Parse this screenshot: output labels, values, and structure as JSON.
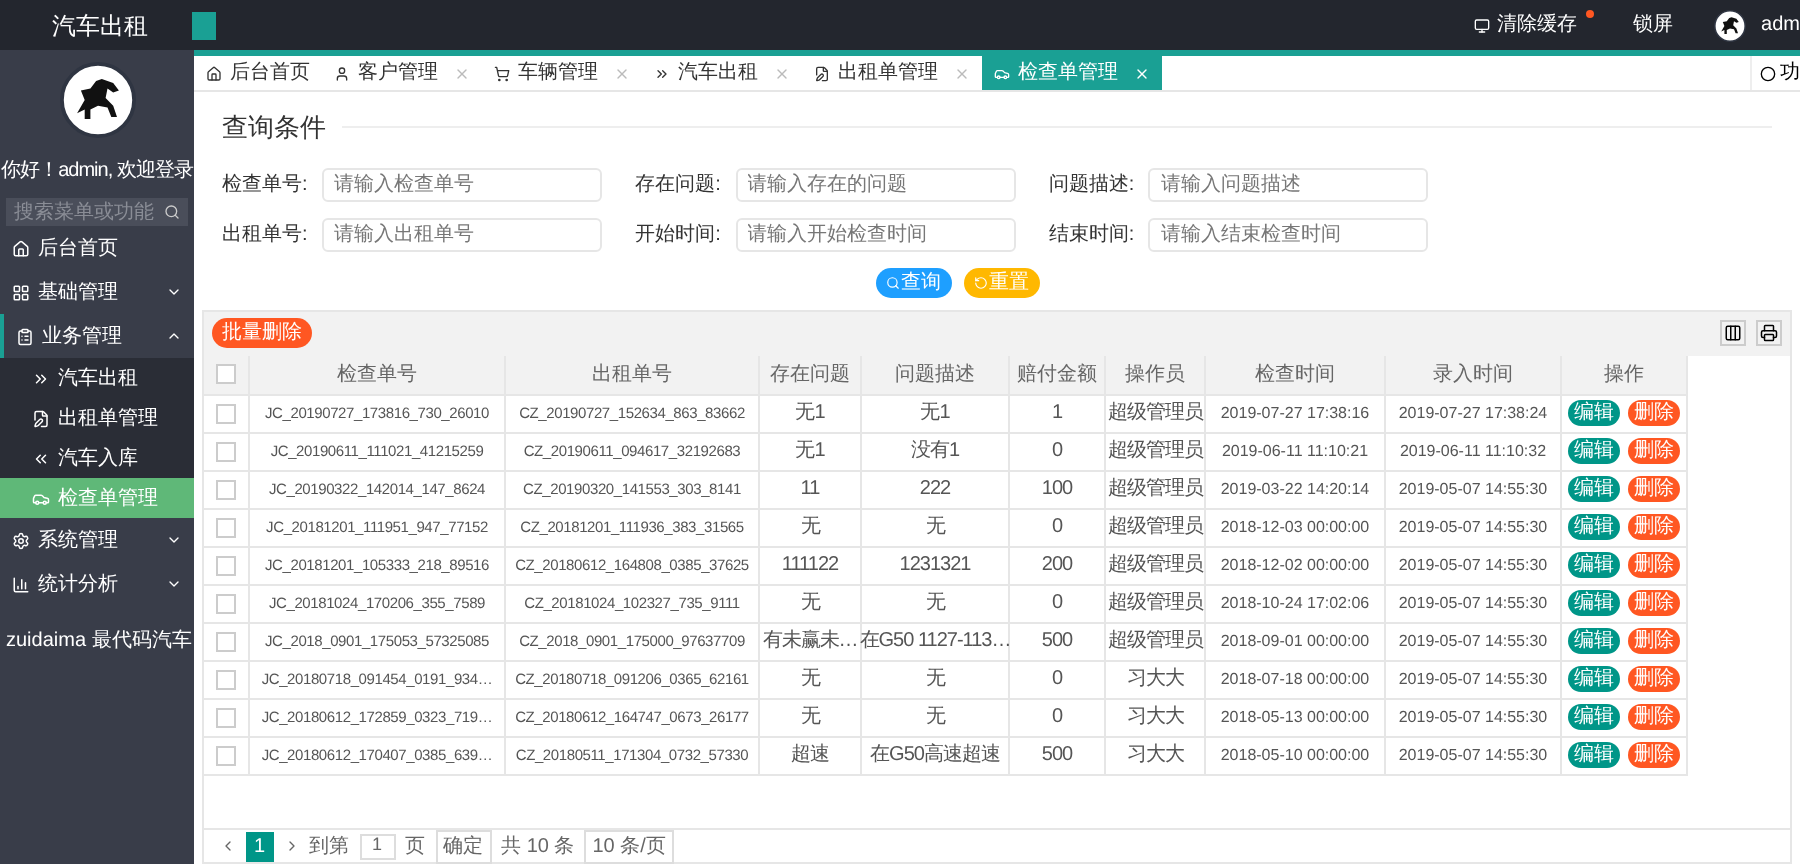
{
  "brand": "汽车出租",
  "topbar": {
    "items": [
      {
        "kind": "cache",
        "label": "清除缓存",
        "badge": true
      },
      {
        "kind": "lock",
        "label": "锁屏"
      },
      {
        "kind": "user",
        "label": "adm"
      }
    ]
  },
  "sidebar": {
    "greeting": "你好！admin, 欢迎登录",
    "search": {
      "placeholder": "搜索菜单或功能"
    },
    "items": [
      {
        "kind": "home",
        "label": "后台首页",
        "expanded": false
      },
      {
        "kind": "grid",
        "label": "基础管理",
        "expanded": false
      },
      {
        "kind": "business",
        "label": "业务管理",
        "expanded": true,
        "children": [
          {
            "kind": "rent",
            "label": "汽车出租",
            "selected": false
          },
          {
            "kind": "order",
            "label": "出租单管理",
            "selected": false
          },
          {
            "kind": "store",
            "label": "汽车入库",
            "selected": false
          },
          {
            "kind": "check",
            "label": "检查单管理",
            "selected": true
          }
        ]
      },
      {
        "kind": "gear",
        "label": "系统管理",
        "expanded": false
      },
      {
        "kind": "stats",
        "label": "统计分析",
        "expanded": false
      }
    ],
    "footer": "zuidaima 最代码汽车"
  },
  "tabs": [
    {
      "kind": "home",
      "label": "后台首页",
      "closable": false,
      "selected": false
    },
    {
      "kind": "user",
      "label": "客户管理",
      "closable": true,
      "selected": false
    },
    {
      "kind": "cart",
      "label": "车辆管理",
      "closable": true,
      "selected": false
    },
    {
      "kind": "rent",
      "label": "汽车出租",
      "closable": true,
      "selected": false
    },
    {
      "kind": "order",
      "label": "出租单管理",
      "closable": true,
      "selected": false
    },
    {
      "kind": "check",
      "label": "检查单管理",
      "closable": true,
      "selected": true
    }
  ],
  "tab_menu": "功",
  "query": {
    "title": "查询条件",
    "fields": [
      {
        "label": "检查单号:",
        "placeholder": "请输入检查单号"
      },
      {
        "label": "存在问题:",
        "placeholder": "请输入存在的问题"
      },
      {
        "label": "问题描述:",
        "placeholder": "请输入问题描述"
      },
      {
        "label": "出租单号:",
        "placeholder": "请输入出租单号"
      },
      {
        "label": "开始时间:",
        "placeholder": "请输入开始检查时间"
      },
      {
        "label": "结束时间:",
        "placeholder": "请输入结束检查时间"
      }
    ],
    "buttons": [
      {
        "kind": "search",
        "label": "查询"
      },
      {
        "kind": "reset",
        "label": "重置"
      }
    ]
  },
  "table": {
    "batch_delete": "批量删除",
    "header_checked": false,
    "columns": [
      "检查单号",
      "出租单号",
      "存在问题",
      "问题描述",
      "赔付金额",
      "操作员",
      "检查时间",
      "录入时间",
      "操作"
    ],
    "rows": [
      {
        "checked": false,
        "cells": [
          "JC_20190727_173816_730_26010",
          "CZ_20190727_152634_863_83662",
          "无1",
          "无1",
          "1",
          "超级管理员",
          "2019-07-27 17:38:16",
          "2019-07-27 17:38:24"
        ],
        "actions": [
          {
            "kind": "edit",
            "label": "编辑"
          },
          {
            "kind": "delete",
            "label": "删除"
          }
        ]
      },
      {
        "checked": false,
        "cells": [
          "JC_20190611_111021_41215259",
          "CZ_20190611_094617_32192683",
          "无1",
          "没有1",
          "0",
          "超级管理员",
          "2019-06-11 11:10:21",
          "2019-06-11 11:10:32"
        ],
        "actions": [
          {
            "kind": "edit",
            "label": "编辑"
          },
          {
            "kind": "delete",
            "label": "删除"
          }
        ]
      },
      {
        "checked": false,
        "cells": [
          "JC_20190322_142014_147_8624",
          "CZ_20190320_141553_303_8141",
          "11",
          "222",
          "100",
          "超级管理员",
          "2019-03-22 14:20:14",
          "2019-05-07 14:55:30"
        ],
        "actions": [
          {
            "kind": "edit",
            "label": "编辑"
          },
          {
            "kind": "delete",
            "label": "删除"
          }
        ]
      },
      {
        "checked": false,
        "cells": [
          "JC_20181201_111951_947_77152",
          "CZ_20181201_111936_383_31565",
          "无",
          "无",
          "0",
          "超级管理员",
          "2018-12-03 00:00:00",
          "2019-05-07 14:55:30"
        ],
        "actions": [
          {
            "kind": "edit",
            "label": "编辑"
          },
          {
            "kind": "delete",
            "label": "删除"
          }
        ]
      },
      {
        "checked": false,
        "cells": [
          "JC_20181201_105333_218_89516",
          "CZ_20180612_164808_0385_37625",
          "111122",
          "1231321",
          "200",
          "超级管理员",
          "2018-12-02 00:00:00",
          "2019-05-07 14:55:30"
        ],
        "actions": [
          {
            "kind": "edit",
            "label": "编辑"
          },
          {
            "kind": "delete",
            "label": "删除"
          }
        ]
      },
      {
        "checked": false,
        "cells": [
          "JC_20181024_170206_355_7589",
          "CZ_20181024_102327_735_9111",
          "无",
          "无",
          "0",
          "超级管理员",
          "2018-10-24 17:02:06",
          "2019-05-07 14:55:30"
        ],
        "actions": [
          {
            "kind": "edit",
            "label": "编辑"
          },
          {
            "kind": "delete",
            "label": "删除"
          }
        ]
      },
      {
        "checked": false,
        "cells": [
          "JC_2018_0901_175053_57325085",
          "CZ_2018_0901_175000_97637709",
          "有未赢未…",
          "在G50 1127-113…",
          "500",
          "超级管理员",
          "2018-09-01 00:00:00",
          "2019-05-07 14:55:30"
        ],
        "actions": [
          {
            "kind": "edit",
            "label": "编辑"
          },
          {
            "kind": "delete",
            "label": "删除"
          }
        ]
      },
      {
        "checked": false,
        "cells": [
          "JC_20180718_091454_0191_934…",
          "CZ_20180718_091206_0365_62161",
          "无",
          "无",
          "0",
          "习大大",
          "2018-07-18 00:00:00",
          "2019-05-07 14:55:30"
        ],
        "actions": [
          {
            "kind": "edit",
            "label": "编辑"
          },
          {
            "kind": "delete",
            "label": "删除"
          }
        ]
      },
      {
        "checked": false,
        "cells": [
          "JC_20180612_172859_0323_719…",
          "CZ_20180612_164747_0673_26177",
          "无",
          "无",
          "0",
          "习大大",
          "2018-05-13 00:00:00",
          "2019-05-07 14:55:30"
        ],
        "actions": [
          {
            "kind": "edit",
            "label": "编辑"
          },
          {
            "kind": "delete",
            "label": "删除"
          }
        ]
      },
      {
        "checked": false,
        "cells": [
          "JC_20180612_170407_0385_639…",
          "CZ_20180511_171304_0732_57330",
          "超速",
          "在G50高速超速",
          "500",
          "习大大",
          "2018-05-10 00:00:00",
          "2019-05-07 14:55:30"
        ],
        "actions": [
          {
            "kind": "edit",
            "label": "编辑"
          },
          {
            "kind": "delete",
            "label": "删除"
          }
        ]
      }
    ]
  },
  "pagination": {
    "pages": [
      {
        "label": "1",
        "selected": true
      }
    ],
    "goto": "到第",
    "page_input": "1",
    "page_unit": "页",
    "confirm": "确定",
    "total": "共 10 条",
    "page_size": "10 条/页"
  }
}
